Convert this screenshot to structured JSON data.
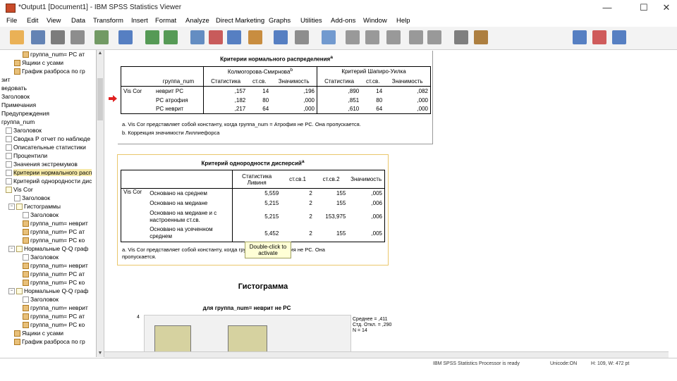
{
  "window": {
    "title": "*Output1 [Document1] - IBM SPSS Statistics Viewer",
    "minimize": "—",
    "maximize": "☐",
    "close": "✕"
  },
  "menu": [
    "File",
    "Edit",
    "View",
    "Data",
    "Transform",
    "Insert",
    "Format",
    "Analyze",
    "Direct Marketing",
    "Graphs",
    "Utilities",
    "Add-ons",
    "Window",
    "Help"
  ],
  "toolbar_icons": [
    "open-icon",
    "save-icon",
    "print-icon",
    "print-preview-icon",
    "export-icon",
    "goto-data-icon",
    "undo-icon",
    "redo-icon",
    "goto-case-icon",
    "goto-variable-icon",
    "variables-icon",
    "use-sets-icon",
    "show-all-icon",
    "spell-icon",
    "chart-icon",
    "stop-icon",
    "back-icon",
    "forward-icon",
    "expand-icon",
    "collapse-icon",
    "show-icon",
    "hide-icon",
    "insert-heading-icon",
    "insert-title-icon",
    "insert-text-icon"
  ],
  "tree": [
    {
      "indent": 30,
      "pm": "",
      "icon": "chart",
      "label": "группа_num= PC ат"
    },
    {
      "indent": 18,
      "pm": "",
      "icon": "chart",
      "label": "Ящики с усами"
    },
    {
      "indent": 18,
      "pm": "",
      "icon": "chart",
      "label": "График разброса по гр"
    },
    {
      "indent": 0,
      "pm": "",
      "icon": "",
      "label": "зит"
    },
    {
      "indent": 0,
      "pm": "",
      "icon": "",
      "label": "ведовать"
    },
    {
      "indent": 0,
      "pm": "",
      "icon": "",
      "label": "Заголовок"
    },
    {
      "indent": 0,
      "pm": "",
      "icon": "",
      "label": "Примечания"
    },
    {
      "indent": 0,
      "pm": "",
      "icon": "",
      "label": "Предупреждения"
    },
    {
      "indent": 0,
      "pm": "",
      "icon": "",
      "label": "группа_num"
    },
    {
      "indent": 6,
      "pm": "",
      "icon": "note",
      "label": "Заголовок"
    },
    {
      "indent": 6,
      "pm": "",
      "icon": "note",
      "label": "Сводка Р отчет по наблюде"
    },
    {
      "indent": 6,
      "pm": "",
      "icon": "note",
      "label": "Описательные статистики"
    },
    {
      "indent": 6,
      "pm": "",
      "icon": "note",
      "label": "Процентили"
    },
    {
      "indent": 6,
      "pm": "",
      "icon": "note",
      "label": "Значения экстремумов"
    },
    {
      "indent": 6,
      "pm": "",
      "icon": "note",
      "label": "Критерии нормального расп",
      "sel": true
    },
    {
      "indent": 6,
      "pm": "",
      "icon": "note",
      "label": "Критерий однородности дис"
    },
    {
      "indent": 6,
      "pm": "",
      "icon": "log",
      "label": "Vis Cor"
    },
    {
      "indent": 18,
      "pm": "",
      "icon": "note",
      "label": "Заголовок"
    },
    {
      "indent": 10,
      "pm": "−",
      "icon": "log",
      "label": "Гистограммы"
    },
    {
      "indent": 30,
      "pm": "",
      "icon": "note",
      "label": "Заголовок"
    },
    {
      "indent": 30,
      "pm": "",
      "icon": "chart",
      "label": "группа_num= неврит"
    },
    {
      "indent": 30,
      "pm": "",
      "icon": "chart",
      "label": "группа_num= PC ат"
    },
    {
      "indent": 30,
      "pm": "",
      "icon": "chart",
      "label": "группа_num= PC ко"
    },
    {
      "indent": 10,
      "pm": "−",
      "icon": "log",
      "label": "Нормальные Q-Q граф"
    },
    {
      "indent": 30,
      "pm": "",
      "icon": "note",
      "label": "Заголовок"
    },
    {
      "indent": 30,
      "pm": "",
      "icon": "chart",
      "label": "группа_num= неврит"
    },
    {
      "indent": 30,
      "pm": "",
      "icon": "chart",
      "label": "группа_num= PC ат"
    },
    {
      "indent": 30,
      "pm": "",
      "icon": "chart",
      "label": "группа_num= PC ко"
    },
    {
      "indent": 10,
      "pm": "−",
      "icon": "log",
      "label": "Нормальные Q-Q граф"
    },
    {
      "indent": 30,
      "pm": "",
      "icon": "note",
      "label": "Заголовок"
    },
    {
      "indent": 30,
      "pm": "",
      "icon": "chart",
      "label": "группа_num= неврит"
    },
    {
      "indent": 30,
      "pm": "",
      "icon": "chart",
      "label": "группа_num= PC ат"
    },
    {
      "indent": 30,
      "pm": "",
      "icon": "chart",
      "label": "группа_num= PC ко"
    },
    {
      "indent": 18,
      "pm": "",
      "icon": "chart",
      "label": "Ящики с усами"
    },
    {
      "indent": 18,
      "pm": "",
      "icon": "chart",
      "label": "График разброса по гр"
    }
  ],
  "normality": {
    "title": "Критерии нормального распределения",
    "title_sup": "a",
    "group_header": "группа_num",
    "ks_header": "Колмогорова-Смирнова",
    "ks_sup": "b",
    "sw_header": "Критерий Шапиро-Уилка",
    "cols": [
      "Статистика",
      "ст.св.",
      "Значимость",
      "Статистика",
      "ст.св.",
      "Значимость"
    ],
    "var": "Vis Cor",
    "rows": [
      {
        "group": "неврит PC",
        "cells": [
          ",157",
          "14",
          ",196",
          ",890",
          "14",
          ",082"
        ]
      },
      {
        "group": "PC атрофия",
        "cells": [
          ",182",
          "80",
          ",000",
          ",851",
          "80",
          ",000"
        ]
      },
      {
        "group": "PC неврит",
        "cells": [
          ",217",
          "64",
          ",000",
          ",610",
          "64",
          ",000"
        ]
      }
    ],
    "foot_a": "a. Vis Cor представляет собой константу, когда группа_num = Атрофия не PC. Она пропускается.",
    "foot_b": "b. Коррекция значимости Лиллиефорса"
  },
  "homogeneity": {
    "title": "Критерий однородности дисперсий",
    "title_sup": "a",
    "cols": [
      "Статистика Ливиня",
      "ст.св.1",
      "ст.св.2",
      "Значимость"
    ],
    "var": "Vis Cor",
    "rows": [
      {
        "basis": "Основано на среднем",
        "cells": [
          "5,559",
          "2",
          "155",
          ",005"
        ]
      },
      {
        "basis": "Основано на медиане",
        "cells": [
          "5,215",
          "2",
          "155",
          ",006"
        ]
      },
      {
        "basis": "Основано на медиане и с настроенным ст.св.",
        "cells": [
          "5,215",
          "2",
          "153,975",
          ",006"
        ]
      },
      {
        "basis": "Основано на усеченном среднем",
        "cells": [
          "5,452",
          "2",
          "155",
          ",005"
        ]
      }
    ],
    "foot_a": "a. Vis Cor представляет собой константу, когда группа_num = Атрофия не PC. Она пропускается."
  },
  "tooltip": "Double-click to activate",
  "histogram": {
    "heading": "Гистограмма",
    "subtitle": "для группа_num= неврит не PC",
    "y_tick": "4",
    "stats": [
      "Среднее = ,411",
      "Стд. Откл. = ,290",
      "N = 14"
    ]
  },
  "status": [
    "IBM SPSS Statistics Processor is ready",
    "Unicode:ON",
    "H: 109, W: 472 pt"
  ]
}
